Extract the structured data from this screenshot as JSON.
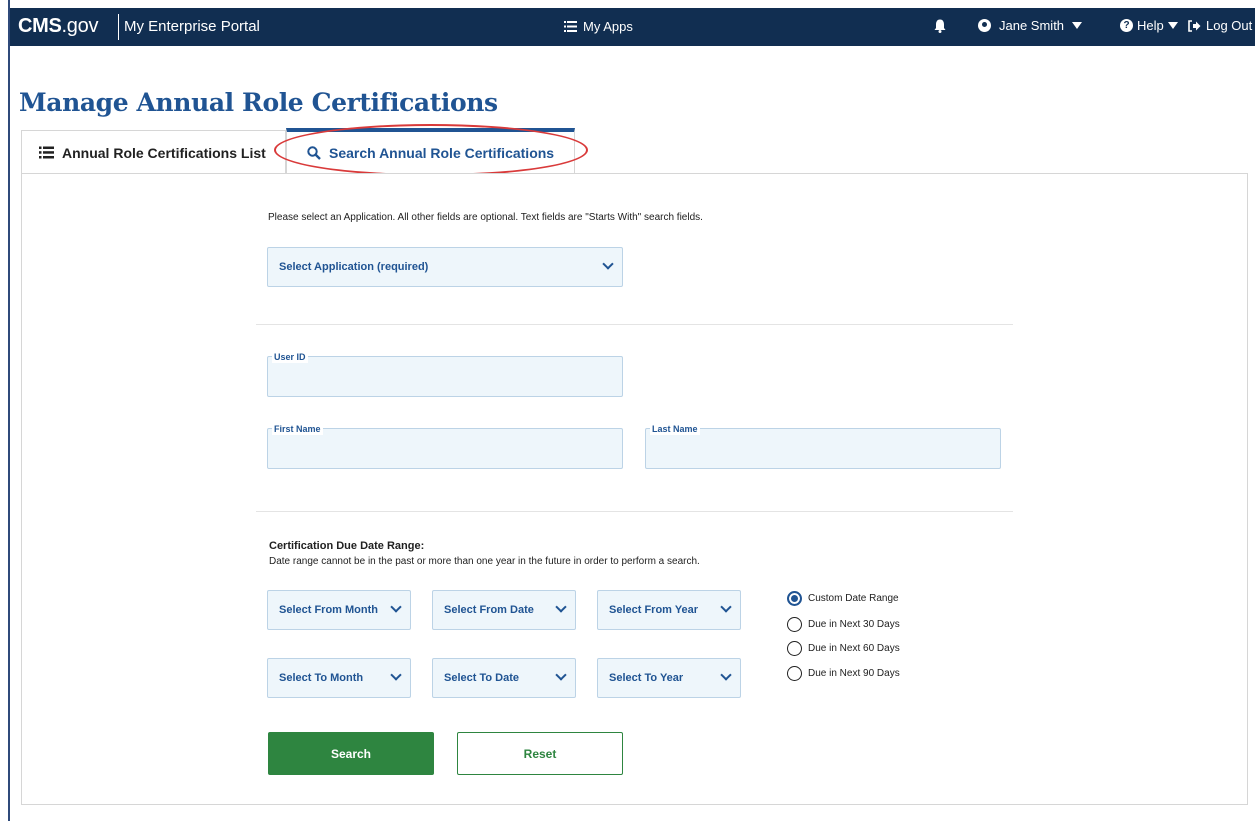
{
  "header": {
    "brand_main": "CMS",
    "brand_suffix": ".gov",
    "portal_name": "My Enterprise Portal",
    "my_apps": "My Apps",
    "user_name": "Jane Smith",
    "help": "Help",
    "logout": "Log Out",
    "bg_color": "#112e51"
  },
  "page": {
    "title": "Manage Annual Role Certifications"
  },
  "tabs": [
    {
      "label": "Annual Role Certifications List",
      "icon": "list-icon",
      "active": false
    },
    {
      "label": "Search Annual Role Certifications",
      "icon": "search-icon",
      "active": true
    }
  ],
  "form": {
    "instructions": "Please select an Application. All other fields are optional. Text fields are \"Starts With\" search fields.",
    "application_select": "Select Application (required)",
    "user_id_label": "User ID",
    "first_name_label": "First Name",
    "last_name_label": "Last Name",
    "user_id_value": "",
    "first_name_value": "",
    "last_name_value": "",
    "date_range_heading": "Certification Due Date Range:",
    "date_range_note": "Date range cannot be in the past or more than one year in the future in order to perform a search.",
    "from_month": "Select From Month",
    "from_date": "Select From Date",
    "from_year": "Select From Year",
    "to_month": "Select To Month",
    "to_date": "Select To Date",
    "to_year": "Select To Year",
    "radio_options": [
      {
        "label": "Custom Date Range",
        "selected": true
      },
      {
        "label": "Due in Next 30 Days",
        "selected": false
      },
      {
        "label": "Due in Next 60 Days",
        "selected": false
      },
      {
        "label": "Due in Next 90 Days",
        "selected": false
      }
    ],
    "search_button": "Search",
    "reset_button": "Reset"
  },
  "colors": {
    "primary": "#205493",
    "action_green": "#2e8540",
    "annotation_red": "#d93a3a"
  }
}
